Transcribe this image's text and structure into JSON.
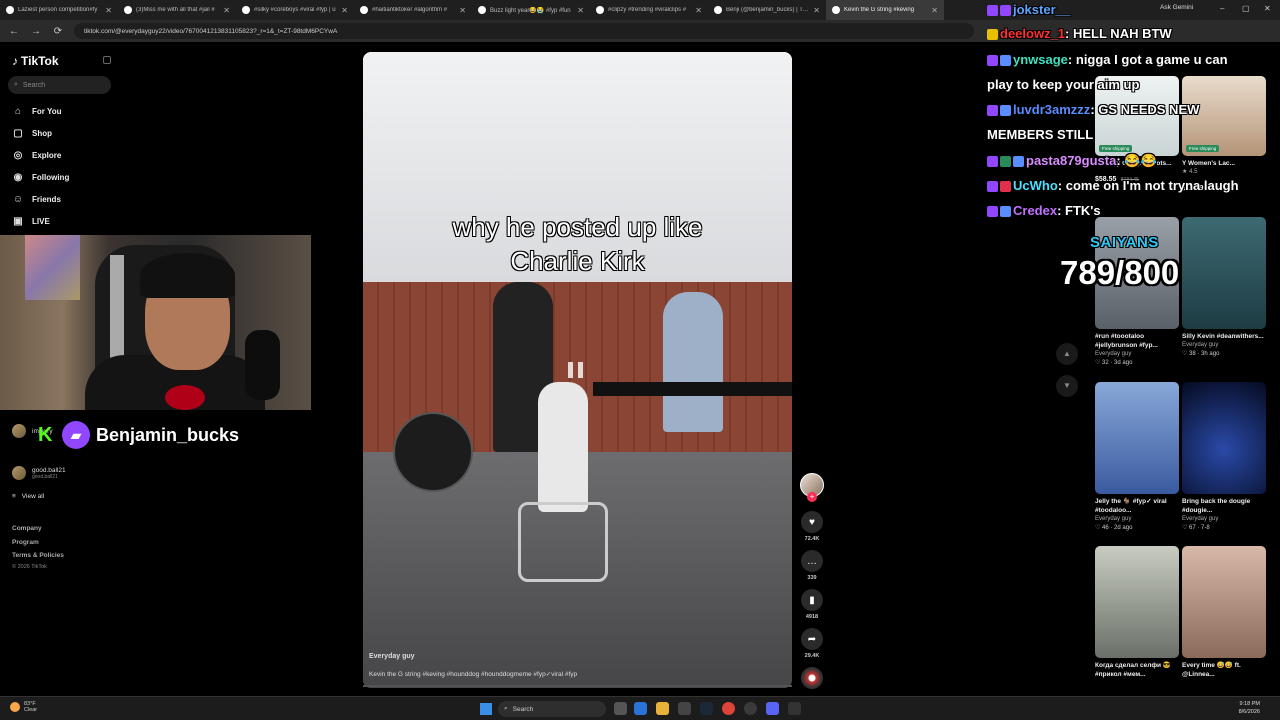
{
  "browser": {
    "tabs": [
      {
        "label": "Laziest person competition#fy"
      },
      {
        "label": "(3)Miss me with all that #jail #"
      },
      {
        "label": "#silky #coreboys #viral #fyp | u"
      },
      {
        "label": "#haitiantiktoker #algorithm #"
      },
      {
        "label": "Buzz light year😂😭 #fyp #fun"
      },
      {
        "label": "#clipzy #trending #viralclips #"
      },
      {
        "label": "Benji (@benjamin_bucks) | TikT"
      },
      {
        "label": "Kevin the G string #keving"
      }
    ],
    "url": "tiktok.com/@everydayguy22/video/7670041213831105823?_r=1&_t=ZT-98tdM6PCYwA",
    "ask_gemini": "Ask Gemini"
  },
  "sidebar": {
    "logo": "TikTok",
    "search_placeholder": "Search",
    "nav": [
      {
        "label": "For You",
        "icon": "home-icon"
      },
      {
        "label": "Shop",
        "icon": "shop-icon"
      },
      {
        "label": "Explore",
        "icon": "compass-icon"
      },
      {
        "label": "Following",
        "icon": "following-icon"
      },
      {
        "label": "Friends",
        "icon": "friends-icon"
      },
      {
        "label": "LIVE",
        "icon": "live-icon"
      }
    ],
    "following": [
      {
        "name": "imjaxry",
        "sub": ""
      },
      {
        "name": "good.ball21",
        "sub": "good.ball21"
      }
    ],
    "view_all": "View all",
    "footer": [
      "Company",
      "Program",
      "Terms & Policies"
    ],
    "copyright": "© 2026 TikTok"
  },
  "streamer": {
    "name": "Benjamin_bucks"
  },
  "video": {
    "caption_line1": "why he posted up like",
    "caption_line2": "Charlie Kirk",
    "author": "Everyday guy",
    "description": "Kevin the G string #keving #hounddog #hounddogmeme #fyp✓viral #fyp",
    "likes": "72.4K",
    "comments": "339",
    "saves": "4918",
    "shares": "29.4K"
  },
  "chat": [
    {
      "user": "jokster__",
      "message": "",
      "color": "#58a6ff"
    },
    {
      "user": "deelowz_1",
      "message": "HELL NAH BTW",
      "color": "#ff3030"
    },
    {
      "user": "ynwsage",
      "message": "nigga I got a game u can",
      "color": "#3fe0c0"
    },
    {
      "user": "",
      "message": "play to keep your aim up",
      "color": "#ffffff"
    },
    {
      "user": "luvdr3amzzz",
      "message": "GS NEEDS NEW",
      "color": "#5a8dff"
    },
    {
      "user": "",
      "message": "MEMBERS STILL",
      "color": "#ffffff"
    },
    {
      "user": "pasta879gusta",
      "message": "😂😂",
      "color": "#d98cff"
    },
    {
      "user": "UcWho",
      "message": "come on I'm not tryna laugh",
      "color": "#4de0ff"
    },
    {
      "user": "Credex",
      "message": "FTK's",
      "color": "#c070ff"
    }
  ],
  "saiyans": {
    "label": "SAIYANS",
    "count": "789/800"
  },
  "shop_cards": [
    {
      "title": "Cowboy Cowgirl Boots...",
      "price": "$58.55",
      "old_price": "$184.45",
      "tag": "Free shipping"
    },
    {
      "title": "Y Women's Lac...",
      "rating": "4.5",
      "price": "$15.99",
      "old_price": "$24.29",
      "tag": "Free shipping"
    }
  ],
  "video_cards": [
    {
      "title": "#run #toootaloo #jellybrunson #fyp...",
      "author": "Everyday guy",
      "meta": "♡ 32 · 3d ago"
    },
    {
      "title": "Silly Kevin #deanwithers...",
      "author": "Everyday guy",
      "meta": "♡ 38 · 3h ago"
    },
    {
      "title": "Jelly the 🐐 #fyp✓ viral #toodaloo...",
      "author": "Everyday guy",
      "meta": "♡ 46 · 2d ago"
    },
    {
      "title": "Bring back the dougie #dougie...",
      "author": "Everyday guy",
      "meta": "♡ 67 · 7-8"
    },
    {
      "title": "Когда сделал селфи 😎 #прикол #мем...",
      "author": "",
      "meta": ""
    },
    {
      "title": "Every time 😅😅 ft. @Linnea...",
      "author": "",
      "meta": ""
    }
  ],
  "taskbar": {
    "weather_temp": "83°F",
    "weather_desc": "Clear",
    "search": "Search",
    "time": "9:18 PM",
    "date": "8/6/2026"
  },
  "colors": {
    "twitch": "#9146ff",
    "kick": "#53fc18",
    "tiktok_red": "#fe2c55",
    "saiyans_blue": "#2fc9f5"
  }
}
